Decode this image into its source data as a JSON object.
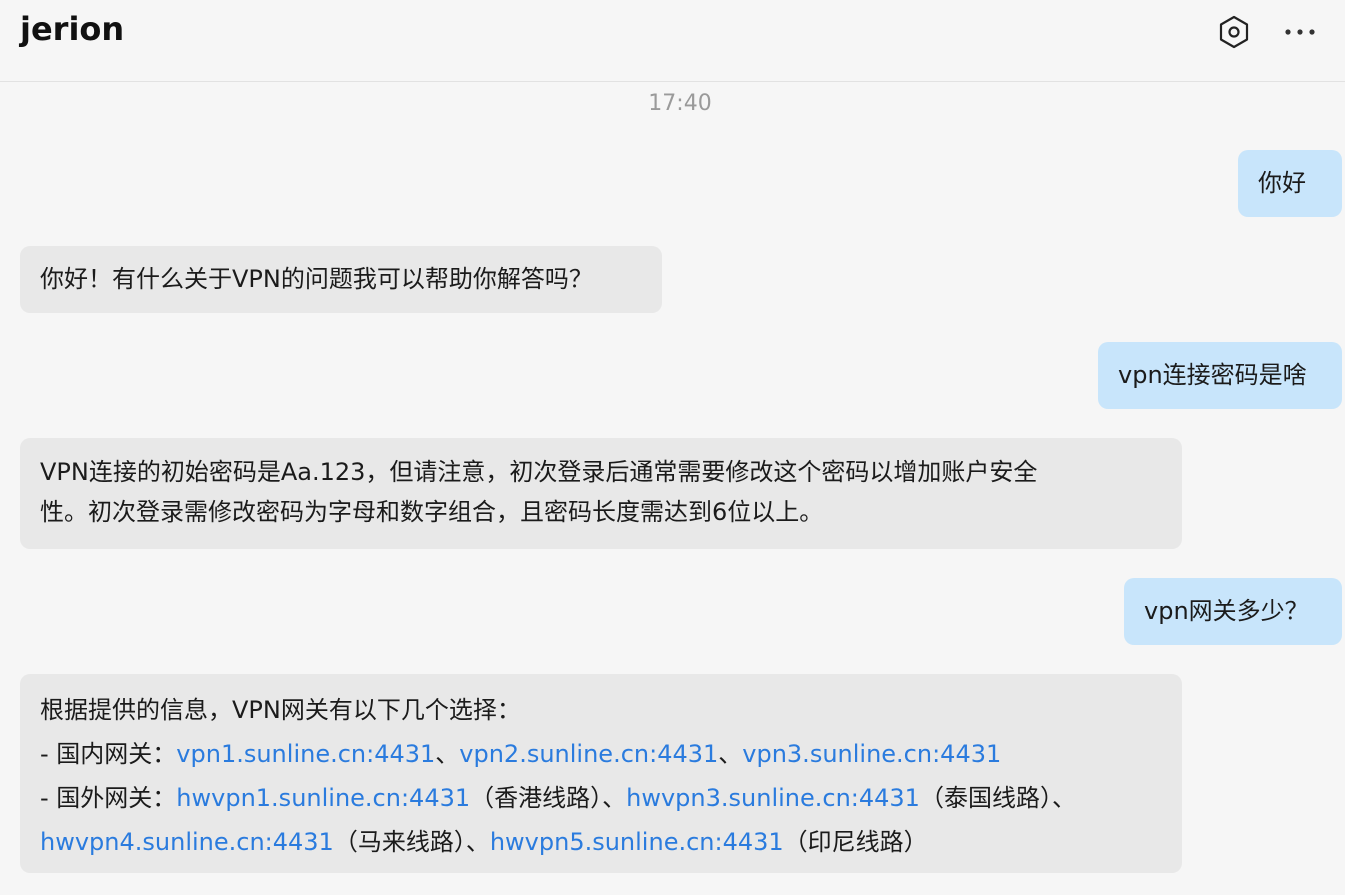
{
  "header": {
    "title": "jerion",
    "settings_icon": "settings-icon",
    "more_icon": "more-icon"
  },
  "chat": {
    "timestamp": "17:40",
    "messages": [
      {
        "role": "user",
        "text": "你好"
      },
      {
        "role": "assistant",
        "text": "你好！有什么关于VPN的问题我可以帮助你解答吗？"
      },
      {
        "role": "user",
        "text": "vpn连接密码是啥"
      },
      {
        "role": "assistant",
        "lines": [
          "VPN连接的初始密码是Aa.123，但请注意，初次登录后通常需要修改这个密码以增加账户安全",
          "性。初次登录需修改密码为字母和数字组合，且密码长度需达到6位以上。"
        ]
      },
      {
        "role": "user",
        "text": "vpn网关多少？"
      },
      {
        "role": "assistant",
        "gateway": {
          "intro": "根据提供的信息，VPN网关有以下几个选择：",
          "domestic_label": "- 国内网关：",
          "domestic": [
            "vpn1.sunline.cn:4431",
            "vpn2.sunline.cn:4431",
            "vpn3.sunline.cn:4431"
          ],
          "separator": "、",
          "overseas_label": "- 国外网关：",
          "overseas": [
            {
              "host": "hwvpn1.sunline.cn:4431",
              "note": "（香港线路）"
            },
            {
              "host": "hwvpn3.sunline.cn:4431",
              "note": "（泰国线路）"
            },
            {
              "host": "hwvpn4.sunline.cn:4431",
              "note": "（马来线路）"
            },
            {
              "host": "hwvpn5.sunline.cn:4431",
              "note": "（印尼线路）"
            }
          ]
        }
      }
    ]
  },
  "colors": {
    "background": "#f6f6f6",
    "user_bubble": "#c8e5fb",
    "bot_bubble": "#e8e8e8",
    "link": "#2a7bde"
  }
}
